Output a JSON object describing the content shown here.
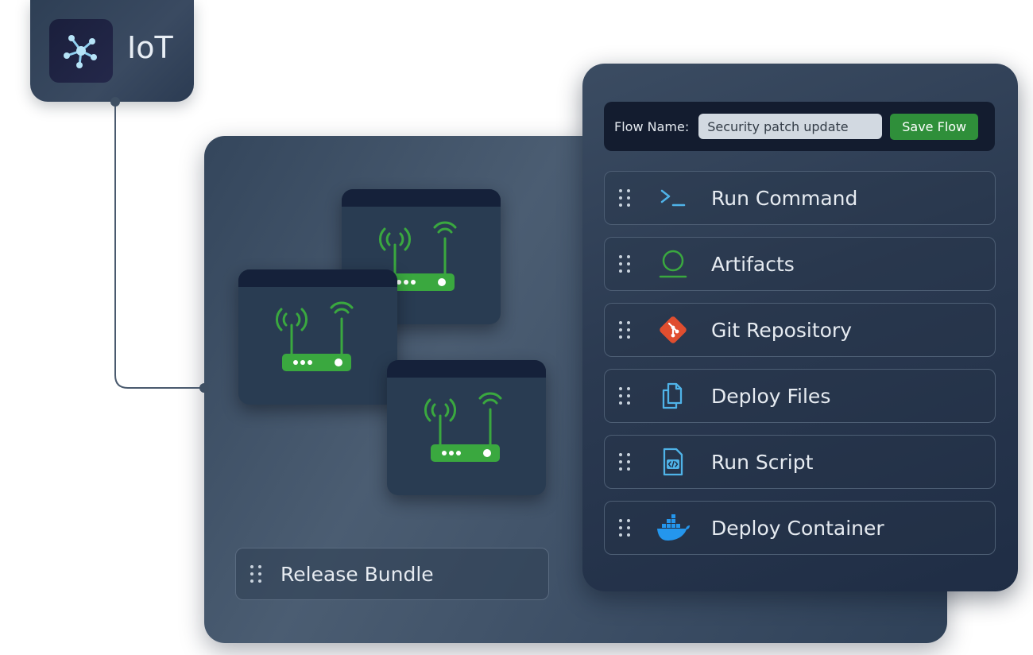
{
  "badge": {
    "label": "IoT",
    "icon": "network-hub-icon"
  },
  "flow": {
    "name_label": "Flow Name:",
    "name_value": "Security patch update",
    "save_label": "Save Flow"
  },
  "steps": [
    {
      "label": "Run Command",
      "icon": "terminal-icon"
    },
    {
      "label": "Artifacts",
      "icon": "artifact-icon"
    },
    {
      "label": "Git Repository",
      "icon": "git-icon"
    },
    {
      "label": "Deploy Files",
      "icon": "files-icon"
    },
    {
      "label": "Run Script",
      "icon": "script-icon"
    },
    {
      "label": "Deploy Container",
      "icon": "docker-icon"
    }
  ],
  "bundle": {
    "label": "Release Bundle"
  },
  "devices": [
    {
      "icon": "router-icon"
    },
    {
      "icon": "router-icon"
    },
    {
      "icon": "router-icon"
    }
  ],
  "colors": {
    "accent_green": "#3aa83f",
    "git_orange": "#e04e2f",
    "docker_blue": "#2496ed",
    "script_blue": "#4fb3e8",
    "panel_dark": "#131c2f"
  }
}
